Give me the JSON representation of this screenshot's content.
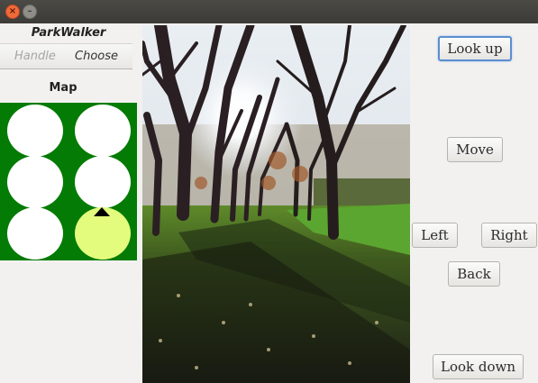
{
  "window": {
    "close_glyph": "×",
    "minimize_glyph": "–"
  },
  "sidebar": {
    "title": "ParkWalker",
    "tabs": [
      {
        "label": "Handle",
        "enabled": false
      },
      {
        "label": "Choose",
        "enabled": true
      }
    ],
    "map_label": "Map",
    "map": {
      "rows": 3,
      "cols": 2,
      "current_cell": {
        "row": 2,
        "col": 1
      },
      "colors": {
        "background": "#047b04",
        "cell": "#ffffff",
        "current": "#e3fc7e",
        "marker": "#000000"
      }
    }
  },
  "view": {
    "image": "park-avenue-trees-sunlight"
  },
  "controls": {
    "look_up": "Look up",
    "move": "Move",
    "left": "Left",
    "right": "Right",
    "back": "Back",
    "look_down": "Look down"
  },
  "colors": {
    "focus": "#5b8ecf",
    "titlebar": "#3c3b37",
    "panel": "#f2f1f0"
  }
}
